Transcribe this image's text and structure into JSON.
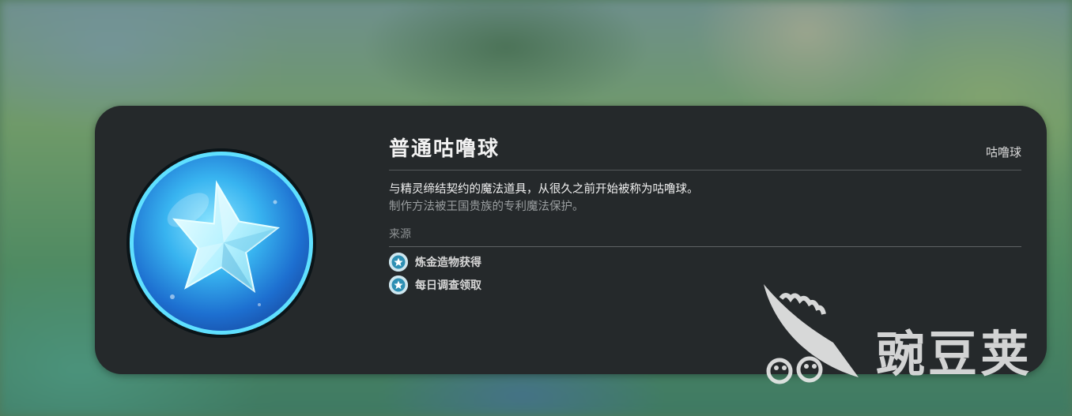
{
  "item": {
    "name": "普通咕噜球",
    "category": "咕噜球",
    "description_line1": "与精灵缔结契约的魔法道具，从很久之前开始被称为咕噜球。",
    "description_line2": "制作方法被王国贵族的专利魔法保护。"
  },
  "source": {
    "label": "来源",
    "items": [
      {
        "text": "炼金造物获得",
        "icon": "source-star-icon"
      },
      {
        "text": "每日调查领取",
        "icon": "source-star-icon"
      }
    ]
  },
  "watermark": {
    "text": "豌豆荚",
    "icon": "pea-pod-logo"
  },
  "colors": {
    "card_bg": "#25292b",
    "orb_blue": "#2fa8e8",
    "orb_rim": "#5fe0ff",
    "icon_bg": "#cfe7ef",
    "icon_fg": "#2d8fb3"
  }
}
